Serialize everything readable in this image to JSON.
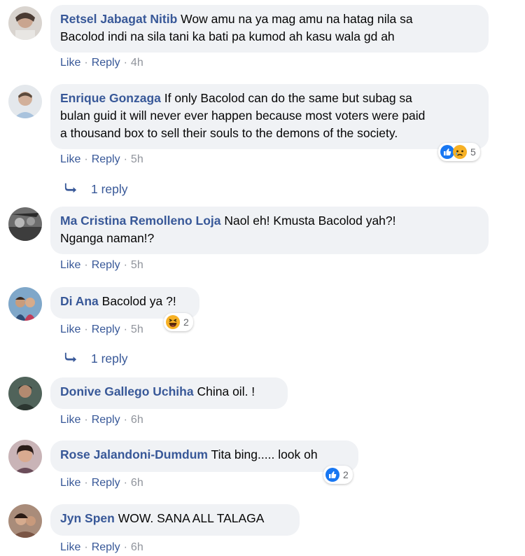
{
  "labels": {
    "like": "Like",
    "reply": "Reply",
    "dot": "·"
  },
  "comments": [
    {
      "author": "Retsel Jabagat Nitib",
      "line1": "Wow amu na ya mag amu na hatag nila sa",
      "line2": "Bacolod indi na sila tani ka bati pa kumod ah kasu wala gd ah",
      "time": "4h"
    },
    {
      "author": "Enrique Gonzaga",
      "line1": "If only Bacolod can do the same but subag sa",
      "line2": "bulan guid it will never ever happen because most voters were paid",
      "line3": "a thousand box to sell their souls to the demons of the society.",
      "time": "5h",
      "reactions": {
        "count": "5",
        "icons": [
          "like",
          "sad"
        ]
      },
      "replies": "1 reply"
    },
    {
      "author": "Ma Cristina Remolleno Loja",
      "line1": "Naol eh! Kmusta Bacolod yah?!",
      "line2": "Nganga naman!?",
      "time": "5h"
    },
    {
      "author": "Di Ana",
      "line1": "Bacolod ya ?!",
      "time": "5h",
      "reactions": {
        "count": "2",
        "icons": [
          "haha"
        ]
      },
      "replies": "1 reply"
    },
    {
      "author": "Donive Gallego Uchiha",
      "line1": "China oil. !",
      "time": "6h"
    },
    {
      "author": "Rose Jalandoni-Dumdum",
      "line1": "Tita bing..... look oh",
      "time": "6h",
      "reactions": {
        "count": "2",
        "icons": [
          "like"
        ]
      }
    },
    {
      "author": "Jyn Spen",
      "line1": "WOW. SANA ALL TALAGA",
      "time": "6h"
    }
  ],
  "colors": {
    "author": "#385898",
    "bubble": "#f0f2f5",
    "like_blue": "#1877f2",
    "emoji_yellow": "#f7b125"
  }
}
